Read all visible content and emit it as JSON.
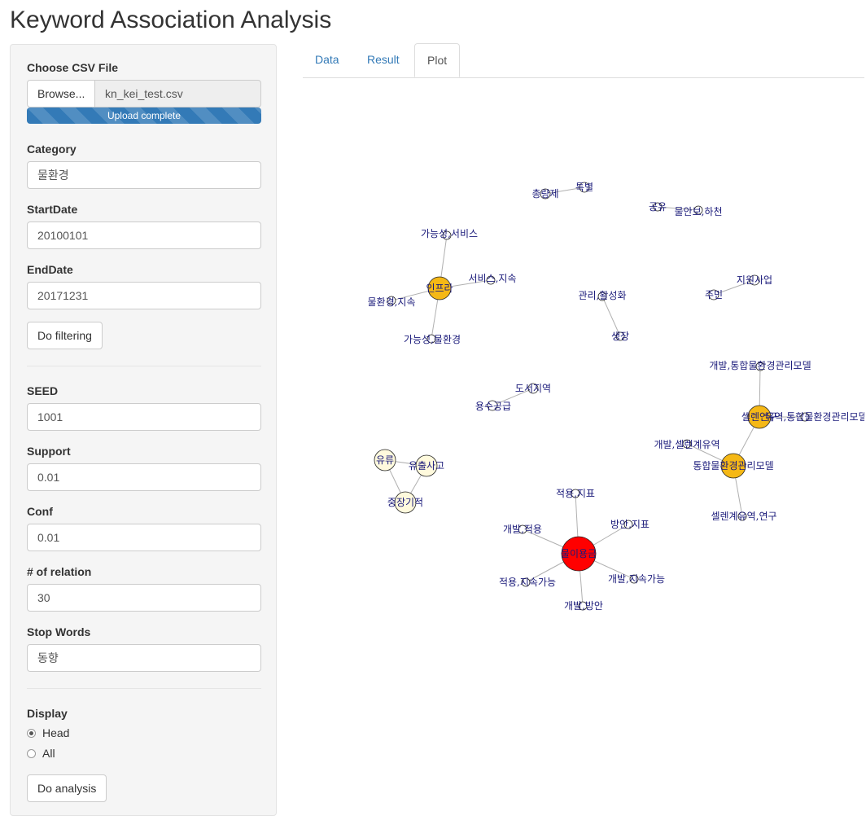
{
  "page": {
    "title": "Keyword Association Analysis"
  },
  "sidebar": {
    "file": {
      "label": "Choose CSV File",
      "browse_label": "Browse...",
      "filename": "kn_kei_test.csv",
      "progress_text": "Upload complete",
      "progress_fraction": 1.0
    },
    "category": {
      "label": "Category",
      "value": "물환경"
    },
    "start_date": {
      "label": "StartDate",
      "value": "20100101"
    },
    "end_date": {
      "label": "EndDate",
      "value": "20171231"
    },
    "filter_button": "Do filtering",
    "seed": {
      "label": "SEED",
      "value": "1001"
    },
    "support": {
      "label": "Support",
      "value": "0.01"
    },
    "conf": {
      "label": "Conf",
      "value": "0.01"
    },
    "relation": {
      "label": "# of relation",
      "value": "30"
    },
    "stop_words": {
      "label": "Stop Words",
      "value": "동향"
    },
    "display": {
      "label": "Display",
      "options": [
        "Head",
        "All"
      ],
      "selected": "Head"
    },
    "analysis_button": "Do analysis"
  },
  "tabs": [
    {
      "label": "Data",
      "active": false
    },
    {
      "label": "Result",
      "active": false
    },
    {
      "label": "Plot",
      "active": true
    }
  ],
  "colors": {
    "accent": "#337ab7",
    "node_red": "#ff0000",
    "node_orange": "#f5b816",
    "node_cream": "#fffadd",
    "edge": "#b0b0b0"
  },
  "network": {
    "labels": [
      "총량제",
      "특별",
      "공유",
      "물안보,하천",
      "가능성,서비스",
      "인프라",
      "서비스,지속",
      "물환경,지속",
      "가능성,물환경",
      "관리,활성화",
      "생장",
      "지원사업",
      "주민",
      "도서지역",
      "용수공급",
      "개발,통합물환경관리모델",
      "셀렌연구",
      "유역,통합물환경관리모델",
      "개발,셀렌계유역",
      "통합물환경관리모델",
      "셀렌계유역,연구",
      "유류",
      "유출사고",
      "중장기적",
      "적용,지표",
      "방안,지표",
      "개발,적용",
      "물이용금",
      "적용,지속가능",
      "개발,지속가능",
      "개발,방안"
    ]
  }
}
